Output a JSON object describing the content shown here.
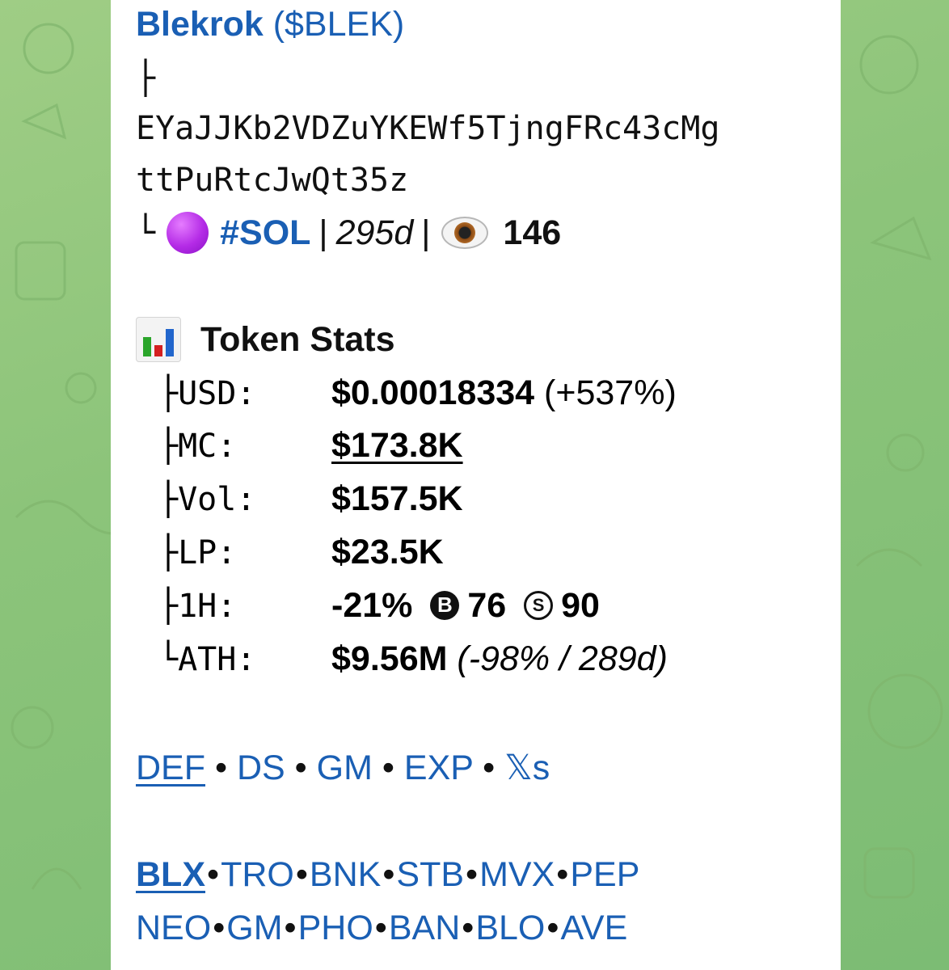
{
  "token": {
    "name": "Blekrok",
    "ticker": "($BLEK)",
    "branch_glyph": "├",
    "contract_line1": "EYaJJKb2VDZuYKEWf5TjngFRc43cMg",
    "contract_line2": "ttPuRtcJwQt35z",
    "end_glyph": "└",
    "chain": "#SOL",
    "age": "295d",
    "views": "146",
    "chain_icon": "purple-circle-icon",
    "views_icon": "eye-icon"
  },
  "stats": {
    "title": "Token Stats",
    "icon": "bar-chart-icon",
    "usd_key": "├USD:",
    "usd_val": "$0.00018334",
    "usd_change": "(+537%)",
    "mc_key": "├MC:",
    "mc_val": "$173.8K",
    "vol_key": "├Vol:",
    "vol_val": "$157.5K",
    "lp_key": "├LP:",
    "lp_val": "$23.5K",
    "h1_key": "├1H:",
    "h1_change": "-21%",
    "h1_buys_glyph": "B",
    "h1_buys": "76",
    "h1_sells_glyph": "S",
    "h1_sells": "90",
    "ath_key": "└ATH:",
    "ath_val": "$9.56M",
    "ath_detail": "(-98% / 289d)"
  },
  "links_row1": [
    "DEF",
    "DS",
    "GM",
    "EXP",
    "𝕏s"
  ],
  "links_row2": [
    "BLX",
    "TRO",
    "BNK",
    "STB",
    "MVX",
    "PEP"
  ],
  "links_row3": [
    "NEO",
    "GM",
    "PHO",
    "BAN",
    "BLO",
    "AVE"
  ],
  "colors": {
    "link": "#1a5fb4",
    "background": "#8cc47a",
    "bubble": "#ffffff"
  }
}
